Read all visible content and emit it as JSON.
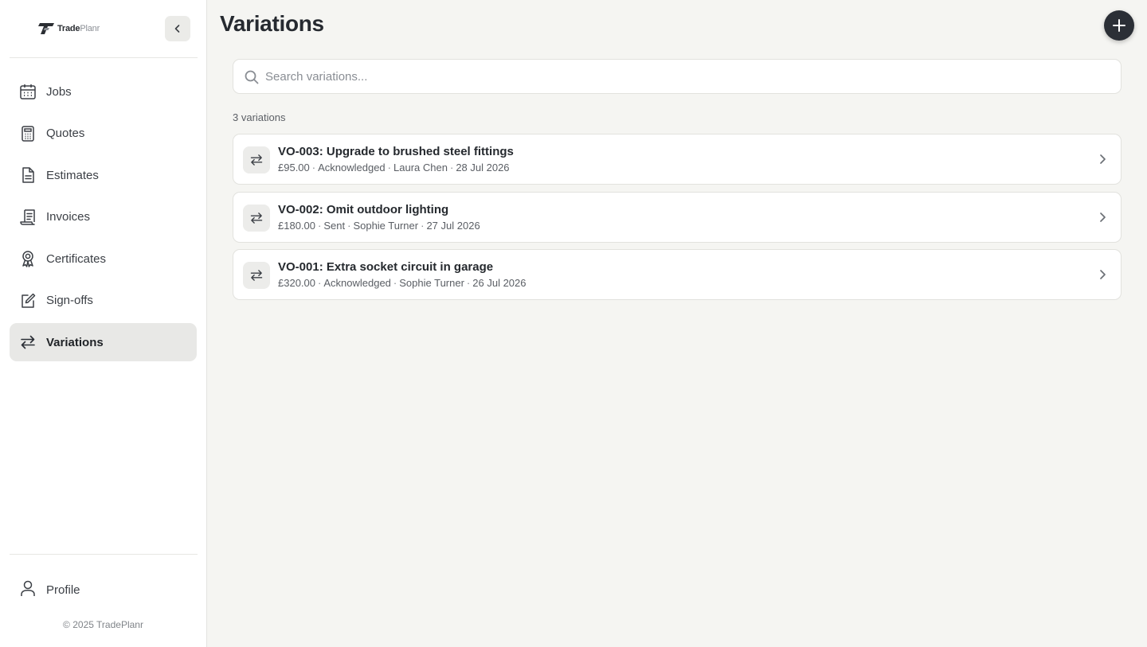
{
  "brand": {
    "name_a": "Trade",
    "name_b": "Planr"
  },
  "sidebar": {
    "items": [
      {
        "id": "jobs",
        "label": "Jobs",
        "icon": "calendar-icon",
        "active": false
      },
      {
        "id": "quotes",
        "label": "Quotes",
        "icon": "calculator-icon",
        "active": false
      },
      {
        "id": "estimates",
        "label": "Estimates",
        "icon": "document-icon",
        "active": false
      },
      {
        "id": "invoices",
        "label": "Invoices",
        "icon": "receipt-icon",
        "active": false
      },
      {
        "id": "certificates",
        "label": "Certificates",
        "icon": "award-icon",
        "active": false
      },
      {
        "id": "signoffs",
        "label": "Sign-offs",
        "icon": "edit-square-icon",
        "active": false
      },
      {
        "id": "variations",
        "label": "Variations",
        "icon": "arrows-swap-icon",
        "active": true
      }
    ],
    "profile_label": "Profile",
    "copyright": "© 2025 TradePlanr"
  },
  "main": {
    "title": "Variations",
    "search": {
      "placeholder": "Search variations...",
      "value": ""
    },
    "count_label": "3 variations",
    "variations": [
      {
        "title": "VO-003: Upgrade to brushed steel fittings",
        "amount": "£95.00",
        "status": "Acknowledged",
        "person": "Laura Chen",
        "date": "28 Jul 2026"
      },
      {
        "title": "VO-002: Omit outdoor lighting",
        "amount": "£180.00",
        "status": "Sent",
        "person": "Sophie Turner",
        "date": "27 Jul 2026"
      },
      {
        "title": "VO-001: Extra socket circuit in garage",
        "amount": "£320.00",
        "status": "Acknowledged",
        "person": "Sophie Turner",
        "date": "26 Jul 2026"
      }
    ]
  },
  "colors": {
    "accent_dark": "#2b2f36",
    "active_bg": "#e8e8e6",
    "page_bg": "#f5f5f2"
  }
}
